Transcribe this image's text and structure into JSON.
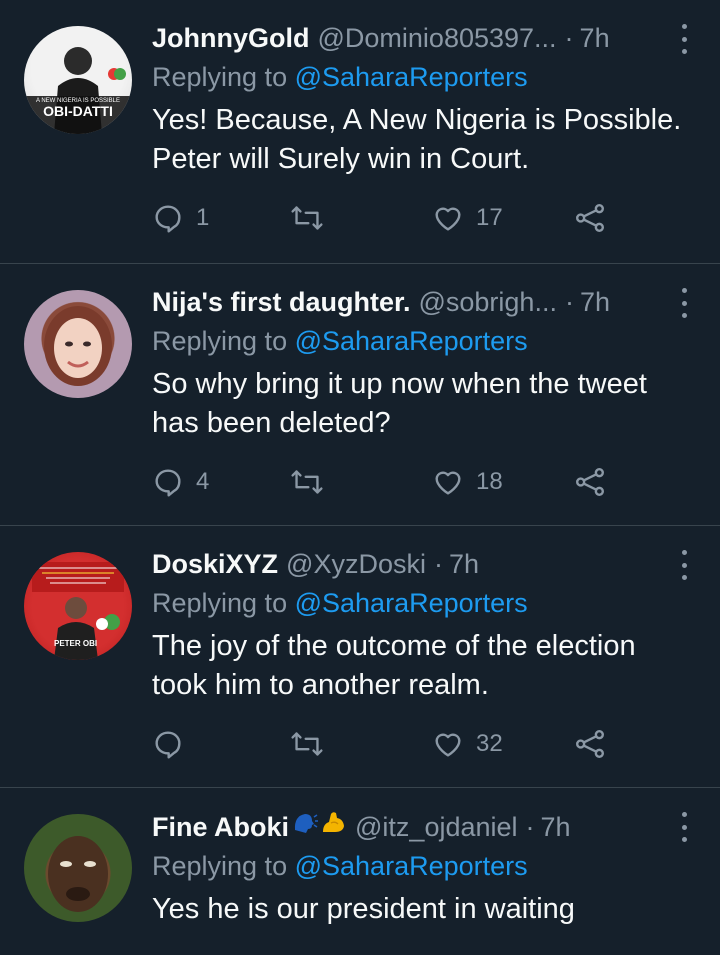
{
  "tweets": [
    {
      "name": "JohnnyGold",
      "handle": "@Dominio805397...",
      "time": "7h",
      "reply_prefix": "Replying to",
      "reply_to": "@SaharaReporters",
      "text": "Yes! Because, A New Nigeria is Possible. Peter will Surely win in Court.",
      "replies": "1",
      "retweets": "",
      "likes": "17",
      "avatar_caption_top": "A NEW NIGERIA IS POSSIBLE",
      "avatar_caption_bottom": "OBI-DATTI"
    },
    {
      "name": "Nija's first daughter.",
      "handle": "@sobrigh...",
      "time": "7h",
      "reply_prefix": "Replying to",
      "reply_to": "@SaharaReporters",
      "text": "So why bring it up now when the tweet has been deleted?",
      "replies": "4",
      "retweets": "",
      "likes": "18"
    },
    {
      "name": "DoskiXYZ",
      "handle": "@XyzDoski",
      "time": "7h",
      "reply_prefix": "Replying to",
      "reply_to": "@SaharaReporters",
      "text": "The joy of the outcome of the election took him to another realm.",
      "replies": "",
      "retweets": "",
      "likes": "32",
      "avatar_caption": "PETER OBI"
    },
    {
      "name": "Fine Aboki",
      "name_emoji": [
        "speaking-head-emoji",
        "flexed-biceps-emoji"
      ],
      "handle": "@itz_ojdaniel",
      "time": "7h",
      "reply_prefix": "Replying to",
      "reply_to": "@SaharaReporters",
      "text": "Yes he is our president in waiting"
    }
  ],
  "colors": {
    "background": "#15202b",
    "divider": "#38444d",
    "primary_text": "#f7f9f9",
    "secondary_text": "#8b98a5",
    "accent": "#1d9bf0"
  }
}
